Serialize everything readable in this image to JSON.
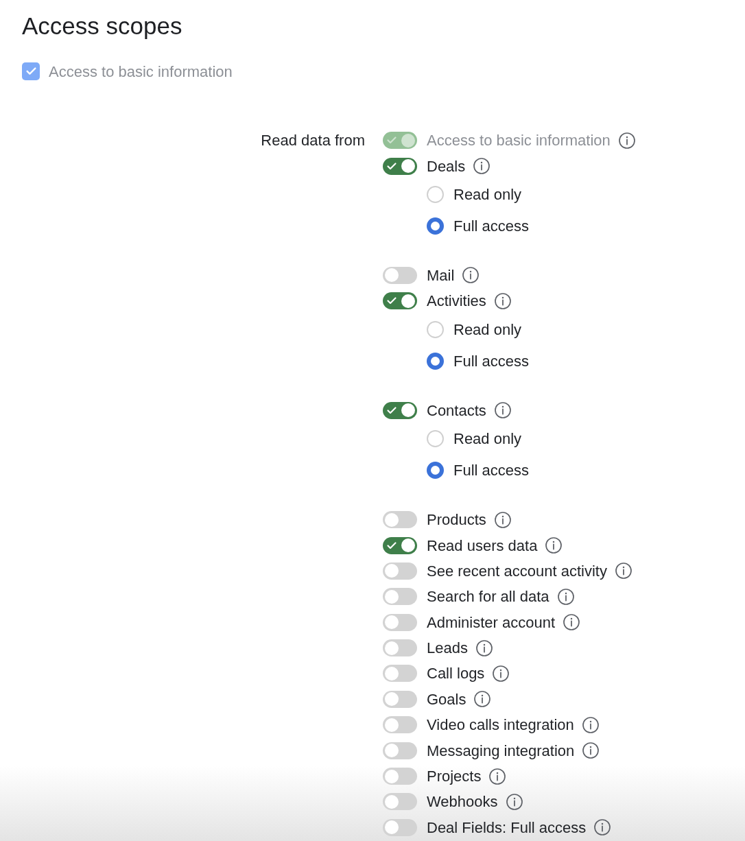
{
  "title": "Access scopes",
  "basic_access": {
    "label": "Access to basic information",
    "checked": true,
    "disabled": true
  },
  "read_data": {
    "label": "Read data from",
    "scopes": [
      {
        "label": "Access to basic information",
        "on": true,
        "disabled": true
      },
      {
        "label": "Deals",
        "on": true,
        "disabled": false,
        "options": [
          {
            "label": "Read only",
            "selected": false
          },
          {
            "label": "Full access",
            "selected": true
          }
        ]
      },
      {
        "label": "Mail",
        "on": false,
        "disabled": false
      },
      {
        "label": "Activities",
        "on": true,
        "disabled": false,
        "options": [
          {
            "label": "Read only",
            "selected": false
          },
          {
            "label": "Full access",
            "selected": true
          }
        ]
      },
      {
        "label": "Contacts",
        "on": true,
        "disabled": false,
        "options": [
          {
            "label": "Read only",
            "selected": false
          },
          {
            "label": "Full access",
            "selected": true
          }
        ]
      },
      {
        "label": "Products",
        "on": false,
        "disabled": false
      },
      {
        "label": "Read users data",
        "on": true,
        "disabled": false
      },
      {
        "label": "See recent account activity",
        "on": false,
        "disabled": false
      },
      {
        "label": "Search for all data",
        "on": false,
        "disabled": false
      },
      {
        "label": "Administer account",
        "on": false,
        "disabled": false
      },
      {
        "label": "Leads",
        "on": false,
        "disabled": false
      },
      {
        "label": "Call logs",
        "on": false,
        "disabled": false
      },
      {
        "label": "Goals",
        "on": false,
        "disabled": false
      },
      {
        "label": "Video calls integration",
        "on": false,
        "disabled": false
      },
      {
        "label": "Messaging integration",
        "on": false,
        "disabled": false
      },
      {
        "label": "Projects",
        "on": false,
        "disabled": false
      },
      {
        "label": "Webhooks",
        "on": false,
        "disabled": false
      },
      {
        "label": "Deal Fields: Full access",
        "on": false,
        "disabled": false
      }
    ]
  }
}
